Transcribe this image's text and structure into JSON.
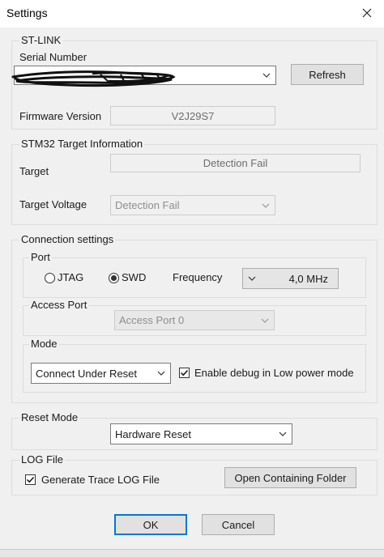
{
  "window": {
    "title": "Settings",
    "close_icon": "close-icon"
  },
  "stlink": {
    "legend": "ST-LINK",
    "serial_label": "Serial Number",
    "serial_value": "",
    "refresh_label": "Refresh",
    "firmware_label": "Firmware Version",
    "firmware_value": "V2J29S7"
  },
  "target_info": {
    "legend": "STM32 Target Information",
    "target_label": "Target",
    "target_value": "Detection Fail",
    "voltage_label": "Target Voltage",
    "voltage_value": "Detection Fail"
  },
  "connection": {
    "legend": "Connection settings",
    "port": {
      "legend": "Port",
      "jtag_label": "JTAG",
      "swd_label": "SWD",
      "selected": "SWD",
      "frequency_label": "Frequency",
      "frequency_value": "4,0 MHz"
    },
    "access_port": {
      "legend": "Access Port",
      "value": "Access Port 0"
    },
    "mode": {
      "legend": "Mode",
      "value": "Connect Under Reset",
      "low_power_label": "Enable debug in Low power mode",
      "low_power_checked": true
    }
  },
  "reset_mode": {
    "legend": "Reset Mode",
    "value": "Hardware Reset"
  },
  "log_file": {
    "legend": "LOG File",
    "generate_label": "Generate Trace LOG File",
    "generate_checked": true,
    "open_folder_label": "Open Containing Folder"
  },
  "footer": {
    "ok_label": "OK",
    "cancel_label": "Cancel"
  }
}
